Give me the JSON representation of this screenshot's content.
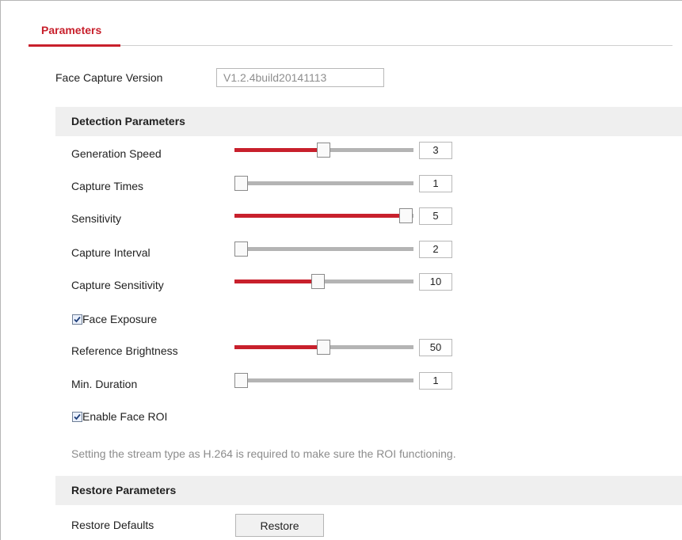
{
  "tabs": [
    {
      "label": "Parameters",
      "active": true
    }
  ],
  "face_capture": {
    "label": "Face Capture Version",
    "value": "V1.2.4build20141113"
  },
  "detection": {
    "heading": "Detection Parameters",
    "sliders": [
      {
        "label": "Generation Speed",
        "value": "3",
        "level_fraction": 0.5
      },
      {
        "label": "Capture Times",
        "value": "1",
        "level_fraction": 0.0
      },
      {
        "label": "Sensitivity",
        "value": "5",
        "level_fraction": 1.0
      },
      {
        "label": "Capture Interval",
        "value": "2",
        "level_fraction": 0.0
      },
      {
        "label": "Capture Sensitivity",
        "value": "10",
        "level_fraction": 0.47
      },
      {
        "label": "Reference Brightness",
        "value": "50",
        "level_fraction": 0.5
      },
      {
        "label": "Min. Duration",
        "value": "1",
        "level_fraction": 0.0
      }
    ],
    "face_exposure": {
      "label": "Face Exposure",
      "checked": true
    },
    "face_roi": {
      "label": "Enable Face ROI",
      "checked": true
    },
    "note": "Setting the stream type as H.264 is required to make sure the ROI functioning."
  },
  "restore": {
    "heading": "Restore Parameters",
    "label": "Restore Defaults",
    "button": "Restore"
  },
  "colors": {
    "accent": "#c8202c",
    "track": "#b4b4b4",
    "section_bg": "#efefef"
  }
}
